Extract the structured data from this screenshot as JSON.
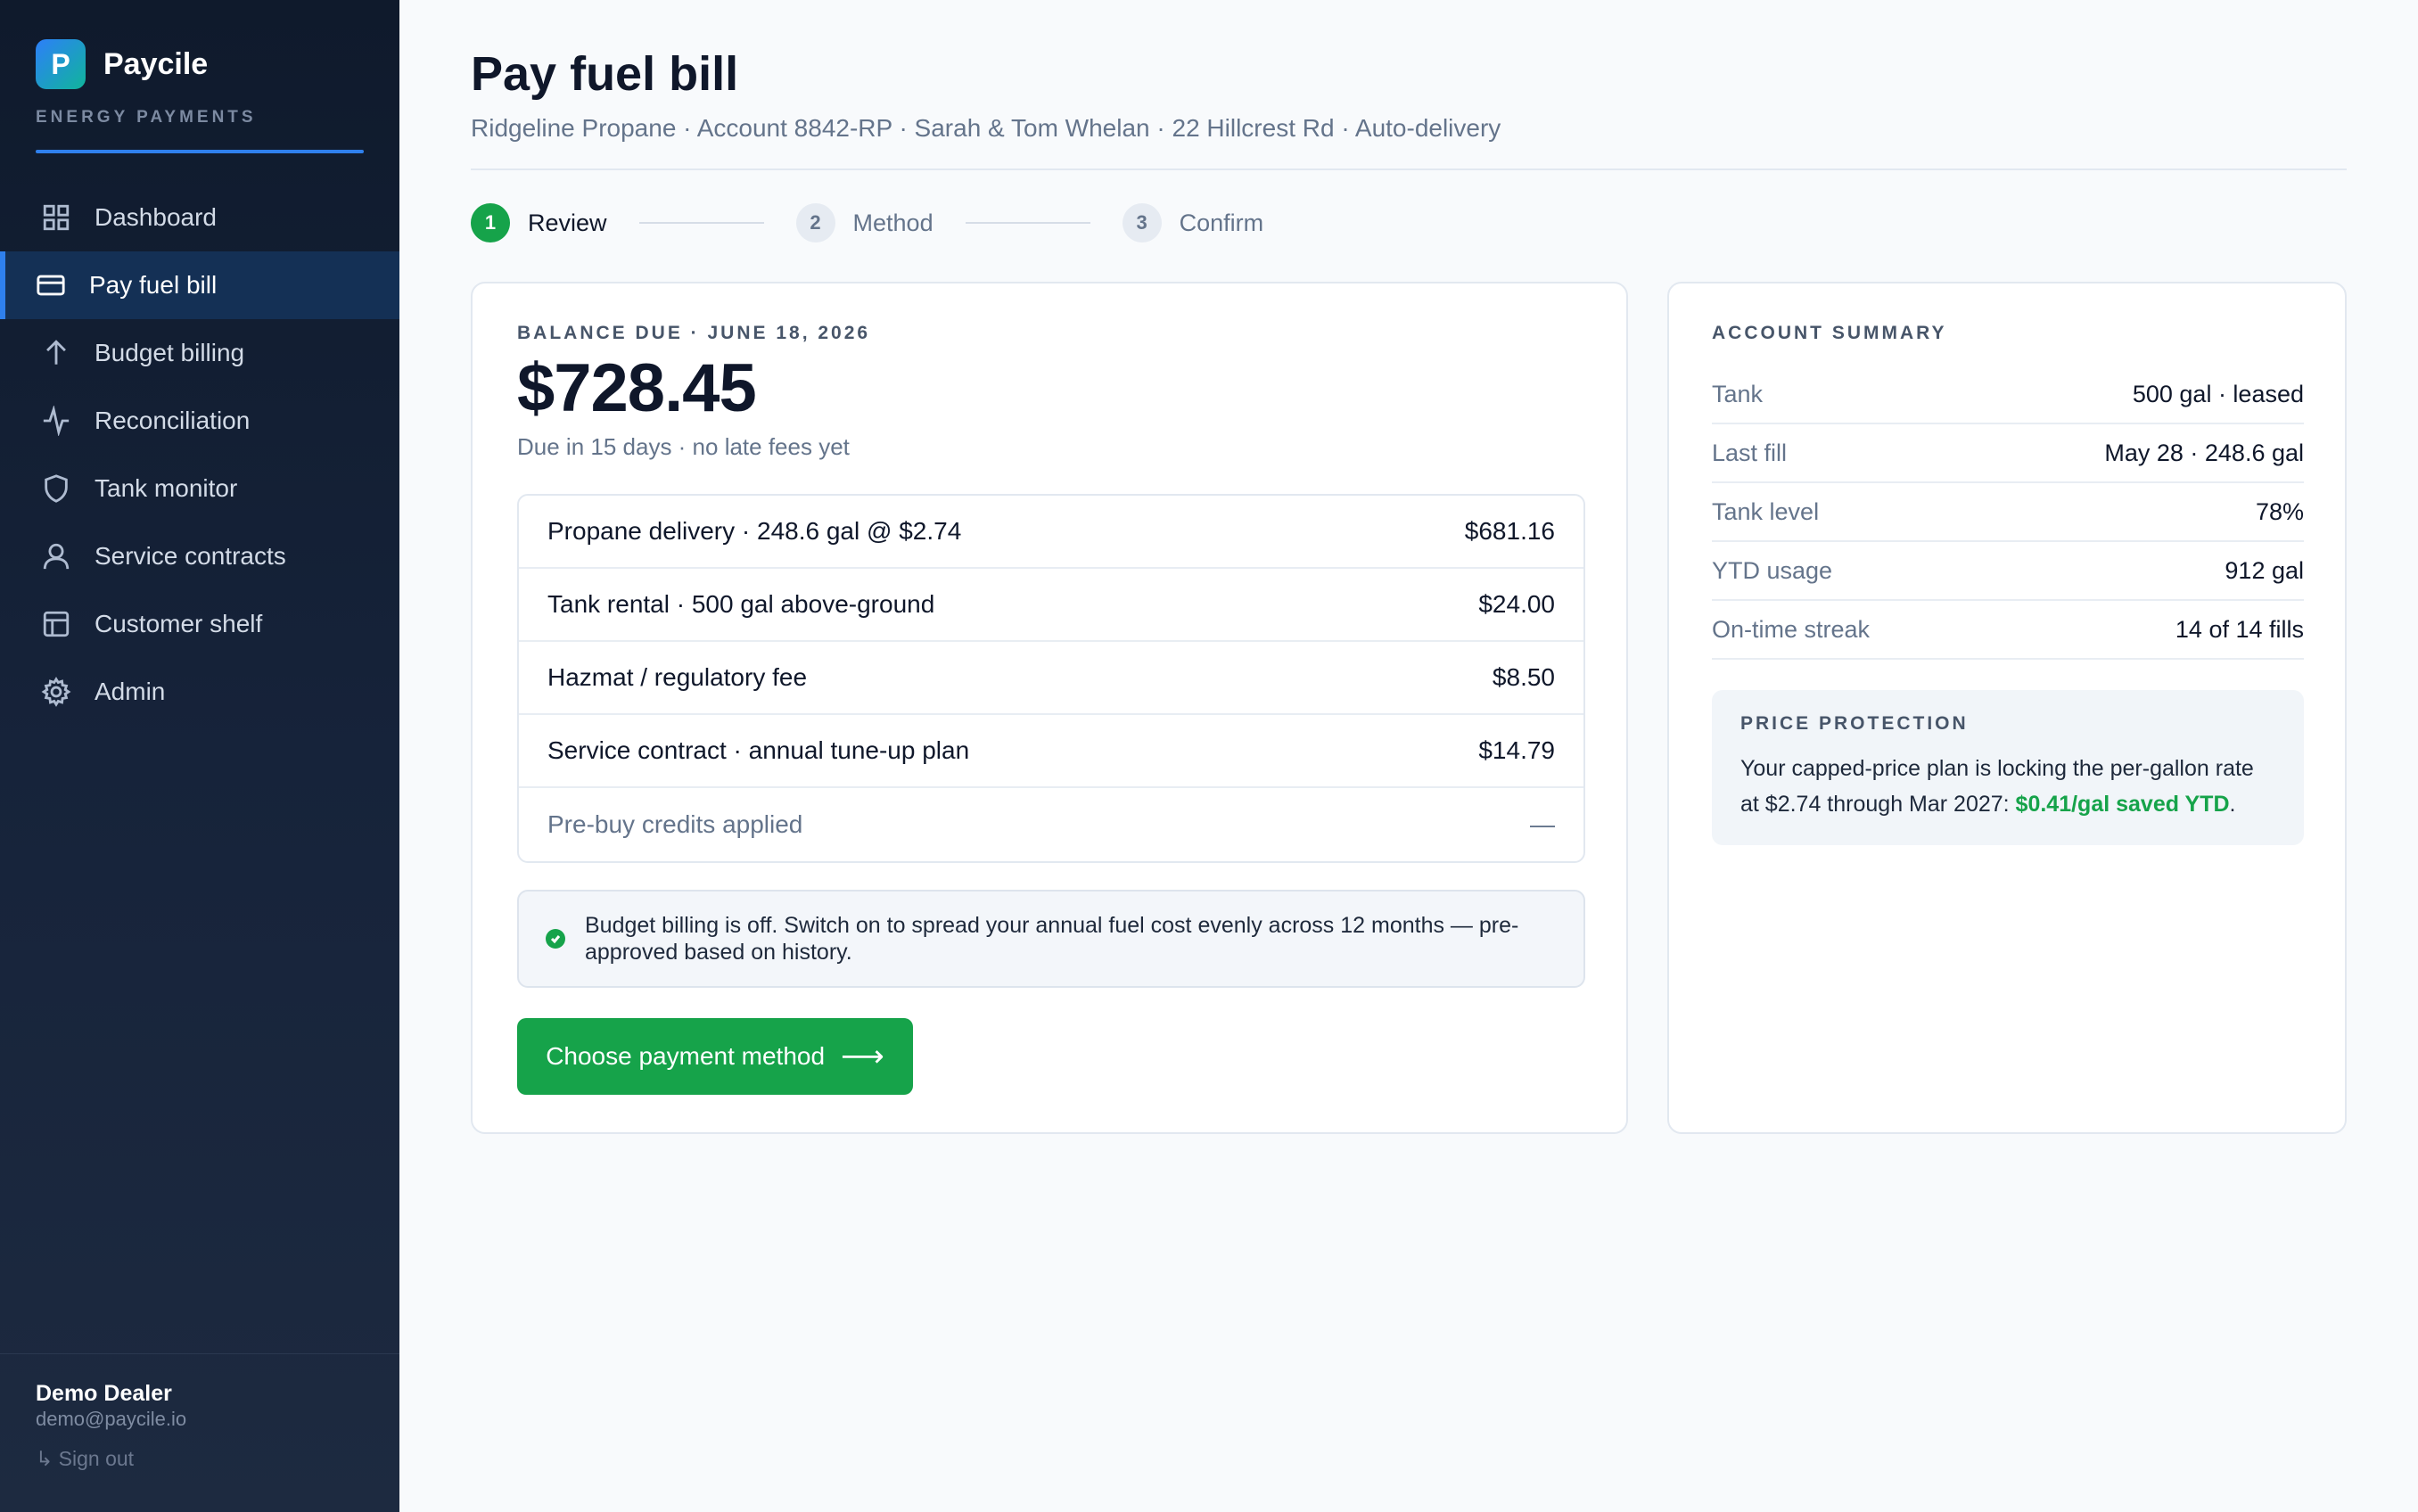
{
  "brand": {
    "logo_letter": "P",
    "name": "Paycile",
    "subtitle": "ENERGY PAYMENTS",
    "accent": "#2f80ed"
  },
  "sidebar": {
    "items": [
      {
        "label": "Dashboard",
        "icon": "grid-icon",
        "active": false
      },
      {
        "label": "Pay fuel bill",
        "icon": "credit-card-icon",
        "active": true
      },
      {
        "label": "Budget billing",
        "icon": "arrow-up-icon",
        "active": false
      },
      {
        "label": "Reconciliation",
        "icon": "activity-icon",
        "active": false
      },
      {
        "label": "Tank monitor",
        "icon": "shield-icon",
        "active": false
      },
      {
        "label": "Service contracts",
        "icon": "user-icon",
        "active": false
      },
      {
        "label": "Customer shelf",
        "icon": "table-icon",
        "active": false
      },
      {
        "label": "Admin",
        "icon": "gear-icon",
        "active": false
      }
    ],
    "user": {
      "name": "Demo Dealer",
      "email": "demo@paycile.io",
      "sign_out": "↳ Sign out"
    }
  },
  "page": {
    "title": "Pay fuel bill",
    "subtitle": "Ridgeline Propane · Account 8842-RP · Sarah & Tom Whelan · 22 Hillcrest Rd · Auto-delivery"
  },
  "stepper": [
    {
      "num": "1",
      "label": "Review",
      "active": true
    },
    {
      "num": "2",
      "label": "Method",
      "active": false
    },
    {
      "num": "3",
      "label": "Confirm",
      "active": false
    }
  ],
  "bill": {
    "due_label": "BALANCE DUE · JUNE 18, 2026",
    "amount": "$728.45",
    "due_note": "Due in 15 days · no late fees yet",
    "line_items": [
      {
        "label": "Propane delivery · 248.6 gal @ $2.74",
        "amount": "$681.16"
      },
      {
        "label": "Tank rental · 500 gal above-ground",
        "amount": "$24.00"
      },
      {
        "label": "Hazmat / regulatory fee",
        "amount": "$8.50"
      },
      {
        "label": "Service contract · annual tune-up plan",
        "amount": "$14.79"
      },
      {
        "label": "Pre-buy credits applied",
        "amount": "—"
      }
    ],
    "notice": "Budget billing is off. Switch on to spread your annual fuel cost evenly across 12 months — pre-approved based on history.",
    "cta": "Choose payment method",
    "cta_arrow": "⟶",
    "cta_color": "#16a34a"
  },
  "summary": {
    "title": "ACCOUNT SUMMARY",
    "rows": [
      {
        "key": "Tank",
        "value": "500 gal · leased"
      },
      {
        "key": "Last fill",
        "value": "May 28 · 248.6 gal"
      },
      {
        "key": "Tank level",
        "value": "78%"
      },
      {
        "key": "YTD usage",
        "value": "912 gal"
      },
      {
        "key": "On-time streak",
        "value": "14 of 14 fills"
      }
    ],
    "protection": {
      "title": "PRICE PROTECTION",
      "text": "Your capped-price plan is locking the per-gallon rate at $2.74 through Mar 2027: ",
      "savings": "$0.41/gal saved YTD",
      "end": "."
    }
  }
}
